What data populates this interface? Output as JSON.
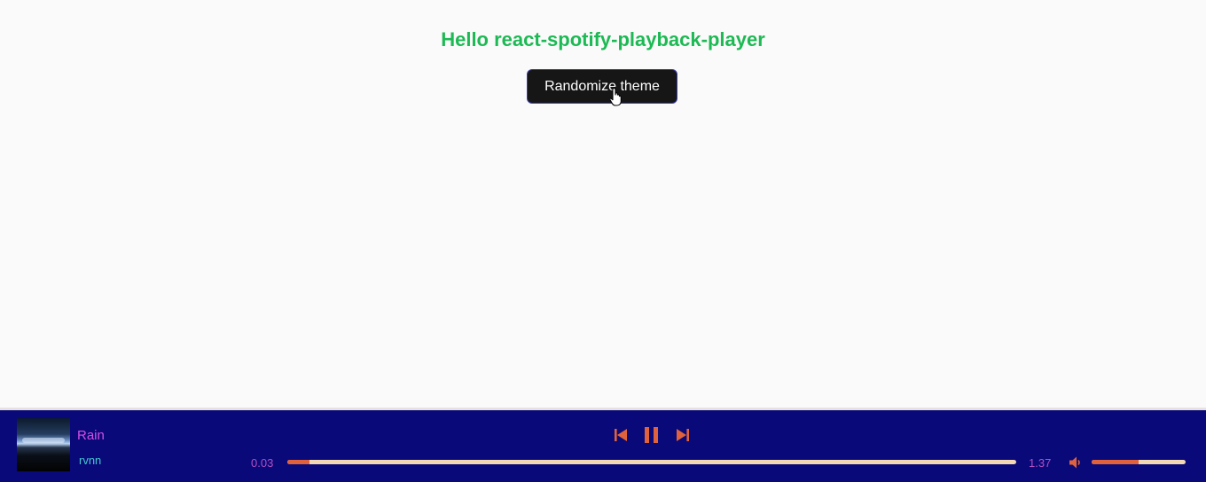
{
  "header": {
    "title": "Hello react-spotify-playback-player",
    "randomize_label": "Randomize theme"
  },
  "player": {
    "track": "Rain",
    "artist": "rvnn",
    "elapsed": "0.03",
    "duration": "1.37",
    "progress_fraction": 0.03,
    "volume_fraction": 0.5,
    "state": "playing",
    "colors": {
      "background": "#090979",
      "track": "#d44fe6",
      "artist": "#46c6cf",
      "time": "#b34fc4",
      "accent": "#e0623c",
      "bar_track": "#f3d8b4"
    },
    "icons": {
      "previous": "skip-previous-icon",
      "pause": "pause-icon",
      "next": "skip-next-icon",
      "volume": "volume-icon"
    }
  }
}
